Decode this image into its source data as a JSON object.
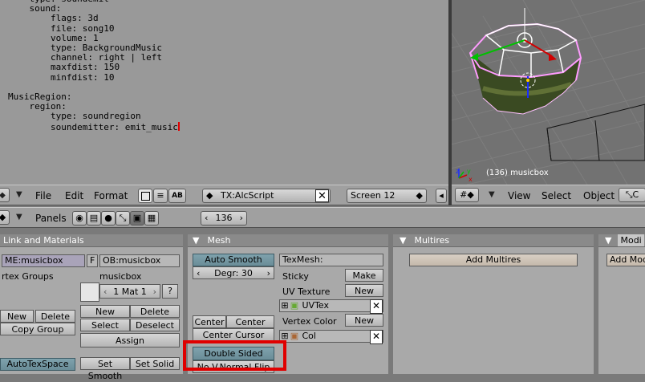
{
  "text_editor": {
    "lines": [
      "    type: soundemit",
      "    sound:",
      "        flags: 3d",
      "        file: song10",
      "        volume: 1",
      "        type: BackgroundMusic",
      "        channel: right | left",
      "        maxfdist: 150",
      "        minfdist: 10",
      "",
      "MusicRegion:",
      "    region:",
      "        type: soundregion"
    ],
    "last_line": "        soundemitter: emit_music"
  },
  "viewport": {
    "object_label": "(136) musicbox",
    "axis_labels": {
      "x": "x",
      "y": "y",
      "z": "z"
    }
  },
  "text_header": {
    "menus": [
      "File",
      "Edit",
      "Format"
    ],
    "ab_label": "AB",
    "script_name": "TX:AlcScript",
    "screen_name": "Screen 12"
  },
  "view_header": {
    "menus": [
      "View",
      "Select",
      "Object"
    ]
  },
  "buttons_header": {
    "panels_label": "Panels",
    "frame": "136"
  },
  "link_materials": {
    "title": "Link and Materials",
    "me_field": "ME:musicbox",
    "f_label": "F",
    "ob_field": "OB:musicbox",
    "vertex_groups_label": "rtex Groups",
    "material_object": "musicbox",
    "mat_selector": "1 Mat 1",
    "question": "?",
    "vg_new": "New",
    "vg_delete": "Delete",
    "copy_group": "Copy Group",
    "mat_new": "New",
    "mat_delete": "Delete",
    "select": "Select",
    "deselect": "Deselect",
    "assign": "Assign",
    "autotexspace": "AutoTexSpace",
    "set_smooth": "Set Smooth",
    "set_solid": "Set Solid"
  },
  "mesh": {
    "title": "Mesh",
    "auto_smooth": "Auto Smooth",
    "degr": "Degr: 30",
    "texmesh": "TexMesh:",
    "sticky": "Sticky",
    "make": "Make",
    "uv_texture": "UV Texture",
    "uv_new": "New",
    "uvtex_name": "UVTex",
    "vertex_color": "Vertex Color",
    "vc_new": "New",
    "col_name": "Col",
    "center": "Center",
    "center_new": "Center New",
    "center_cursor": "Center Cursor",
    "double_sided": "Double Sided",
    "no_v_normal_flip": "No V.Normal Flip"
  },
  "multires": {
    "title": "Multires",
    "add_multires": "Add Multires"
  },
  "modifiers": {
    "title": "Modi",
    "add_modifier": "Add Modi"
  },
  "colors": {
    "highlight": "#e00000",
    "editor_bg": "#999999",
    "panel_bg": "#a9a9a9",
    "selection_pink": "#ff9cff"
  }
}
